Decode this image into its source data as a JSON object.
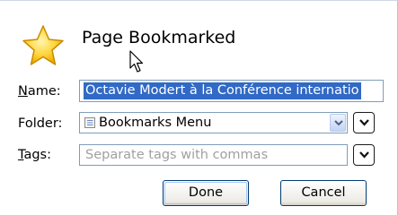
{
  "dialog": {
    "title": "Page Bookmarked",
    "icon": "star-icon"
  },
  "form": {
    "name": {
      "label_key": "N",
      "label_rest": "ame:",
      "value": "Octavie Modert à la Conférence internatio"
    },
    "folder": {
      "label": "Folder:",
      "value": "Bookmarks Menu",
      "icon": "bookmarks-menu-icon"
    },
    "tags": {
      "label_key": "T",
      "label_rest": "ags:",
      "placeholder": "Separate tags with commas"
    }
  },
  "buttons": {
    "done": "Done",
    "cancel": "Cancel"
  },
  "colors": {
    "selection": "#3169c6",
    "field_border": "#7f9db9",
    "star_fill": "#ffd43a"
  }
}
